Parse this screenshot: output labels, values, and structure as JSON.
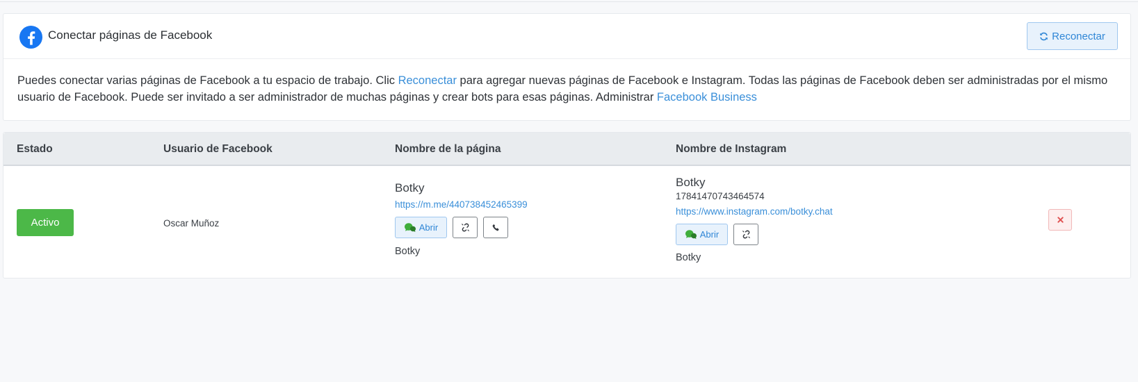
{
  "header": {
    "title": "Conectar páginas de Facebook",
    "reconnect_label": "Reconectar"
  },
  "intro": {
    "part1": "Puedes conectar varias páginas de Facebook a tu espacio de trabajo. Clic ",
    "link1": "Reconectar",
    "part2": " para agregar nuevas páginas de Facebook e Instagram. Todas las páginas de Facebook deben ser administradas por el mismo usuario de Facebook. Puede ser invitado a ser administrador de muchas páginas y crear bots para esas páginas. Administrar ",
    "link2": "Facebook Business"
  },
  "table": {
    "columns": [
      "Estado",
      "Usuario de Facebook",
      "Nombre de la página",
      "Nombre de Instagram"
    ],
    "rows": [
      {
        "status": "Activo",
        "user": "Oscar Muñoz",
        "page": {
          "name": "Botky",
          "link": "https://m.me/440738452465399",
          "open_label": "Abrir",
          "sub_name": "Botky"
        },
        "instagram": {
          "name": "Botky",
          "id": "17841470743464574",
          "link": "https://www.instagram.com/botky.chat",
          "open_label": "Abrir",
          "sub_name": "Botky"
        }
      }
    ]
  },
  "colors": {
    "facebook": "#1877f2",
    "active": "#4cb848",
    "link": "#3a8fd9",
    "danger": "#e05252"
  },
  "icons": [
    "facebook-icon",
    "refresh-icon",
    "messenger-icon",
    "unlink-icon",
    "phone-icon",
    "close-icon"
  ]
}
